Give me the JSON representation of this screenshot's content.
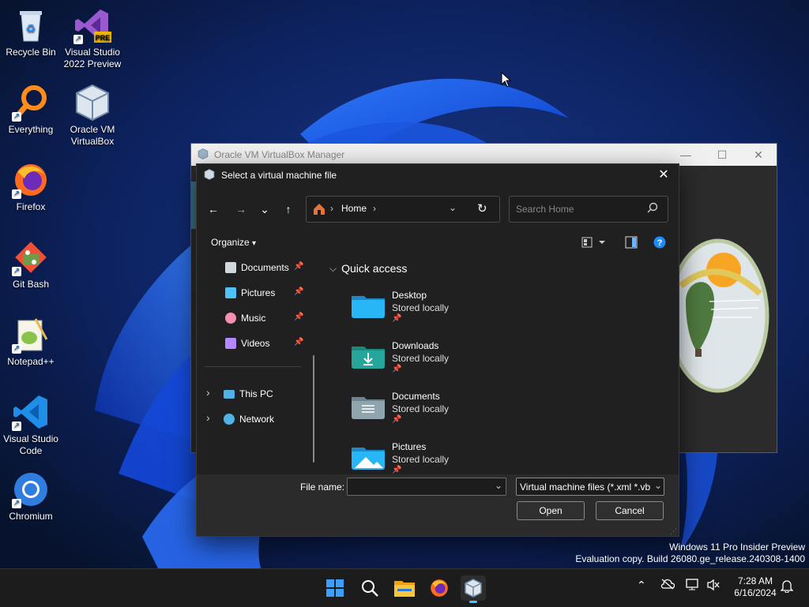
{
  "desktop": {
    "icons": [
      {
        "label": "Recycle Bin",
        "icon": "recycle-bin-icon"
      },
      {
        "label": "Visual Studio 2022 Preview",
        "icon": "visual-studio-icon",
        "badge": "PRE"
      },
      {
        "label": "Everything",
        "icon": "everything-icon"
      },
      {
        "label": "Oracle VM VirtualBox",
        "icon": "virtualbox-icon"
      },
      {
        "label": "Firefox",
        "icon": "firefox-icon"
      },
      {
        "label": "Git Bash",
        "icon": "git-bash-icon"
      },
      {
        "label": "Notepad++",
        "icon": "notepad-plus-plus-icon"
      },
      {
        "label": "Visual Studio Code",
        "icon": "vscode-icon"
      },
      {
        "label": "Chromium",
        "icon": "chromium-icon"
      }
    ],
    "icon_labels_lines": {
      "vs_line1": "Visual Studio",
      "vs_line2": "2022 Preview",
      "vbox_line1": "Oracle VM",
      "vbox_line2": "VirtualBox",
      "vscode_line1": "Visual Studio",
      "vscode_line2": "Code"
    },
    "watermark": {
      "line1": "Windows 11 Pro Insider Preview",
      "line2": "Evaluation copy. Build 26080.ge_release.240308-1400"
    }
  },
  "vbox_window": {
    "title": "Oracle VM VirtualBox Manager",
    "controls": {
      "minimize": "—",
      "maximize": "☐",
      "close": "✕"
    }
  },
  "dialog": {
    "title": "Select a virtual machine file",
    "close_glyph": "✕",
    "nav": {
      "back": "←",
      "forward": "→",
      "recent": "⌄",
      "up": "↑"
    },
    "address": {
      "location": "Home",
      "separator": "›"
    },
    "search": {
      "placeholder": "Search Home"
    },
    "toolbar": {
      "organize_label": "Organize",
      "organize_caret": "▾"
    },
    "sidebar": {
      "pinned": [
        {
          "label": "Documents",
          "icon": "documents-icon",
          "color": "#cfd8dc"
        },
        {
          "label": "Pictures",
          "icon": "pictures-icon",
          "color": "#4fc3f7"
        },
        {
          "label": "Music",
          "icon": "music-icon",
          "color": "#f48fb1"
        },
        {
          "label": "Videos",
          "icon": "videos-icon",
          "color": "#b388ff"
        }
      ],
      "pin_glyph": "📌",
      "expand_glyph": "›",
      "locations": [
        {
          "label": "This PC",
          "icon": "this-pc-icon"
        },
        {
          "label": "Network",
          "icon": "network-icon"
        }
      ]
    },
    "quick_access": {
      "header": "Quick access",
      "header_caret": "⌵",
      "items": [
        {
          "name": "Desktop",
          "status": "Stored locally",
          "icon": "desktop-folder-icon",
          "color": "#29b6f6"
        },
        {
          "name": "Downloads",
          "status": "Stored locally",
          "icon": "downloads-folder-icon",
          "color": "#26a69a"
        },
        {
          "name": "Documents",
          "status": "Stored locally",
          "icon": "documents-folder-icon",
          "color": "#90a4ae"
        },
        {
          "name": "Pictures",
          "status": "Stored locally",
          "icon": "pictures-folder-icon",
          "color": "#29b6f6"
        }
      ]
    },
    "footer": {
      "file_name_label": "File name:",
      "file_name_value": "",
      "file_type": "Virtual machine files (*.xml *.vb",
      "open_label": "Open",
      "cancel_label": "Cancel"
    }
  },
  "taskbar": {
    "apps": [
      "start-icon",
      "search-icon",
      "file-explorer-icon",
      "firefox-icon",
      "virtualbox-icon"
    ],
    "tray": {
      "time": "7:28 AM",
      "date": "6/16/2024",
      "chevron": "⌃"
    }
  },
  "colors": {
    "accent": "#0078d4",
    "dialog_bg": "#202020",
    "taskbar_bg": "#1c1c1c"
  }
}
